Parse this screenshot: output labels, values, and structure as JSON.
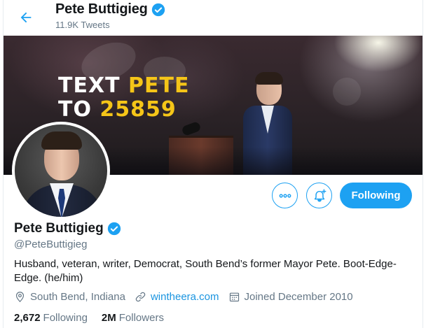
{
  "header": {
    "back_icon": "arrow-left-icon",
    "name": "Pete Buttigieg",
    "verified_icon": "verified-badge-icon",
    "tweet_count": "11.9K Tweets"
  },
  "banner": {
    "line1_white": "TEXT ",
    "line1_yellow": "PETE",
    "line2_white": "TO ",
    "line2_yellow": "25859"
  },
  "actions": {
    "more_icon": "more-dots-icon",
    "notify_icon": "bell-plus-icon",
    "follow_label": "Following"
  },
  "profile": {
    "name": "Pete Buttigieg",
    "handle": "@PeteButtigieg",
    "bio": "Husband, veteran, writer, Democrat, South Bend’s former Mayor Pete. Boot-Edge-Edge. (he/him)",
    "location": "South Bend, Indiana",
    "location_icon": "location-pin-icon",
    "website": "wintheera.com",
    "website_icon": "link-icon",
    "joined": "Joined December 2010",
    "joined_icon": "calendar-icon"
  },
  "stats": {
    "following_count": "2,672",
    "following_label": "Following",
    "followers_count": "2M",
    "followers_label": "Followers"
  },
  "colors": {
    "accent": "#1da1f2",
    "link": "#1b95e0",
    "muted": "#657786",
    "text": "#14171a",
    "banner_yellow": "#f5c518"
  }
}
